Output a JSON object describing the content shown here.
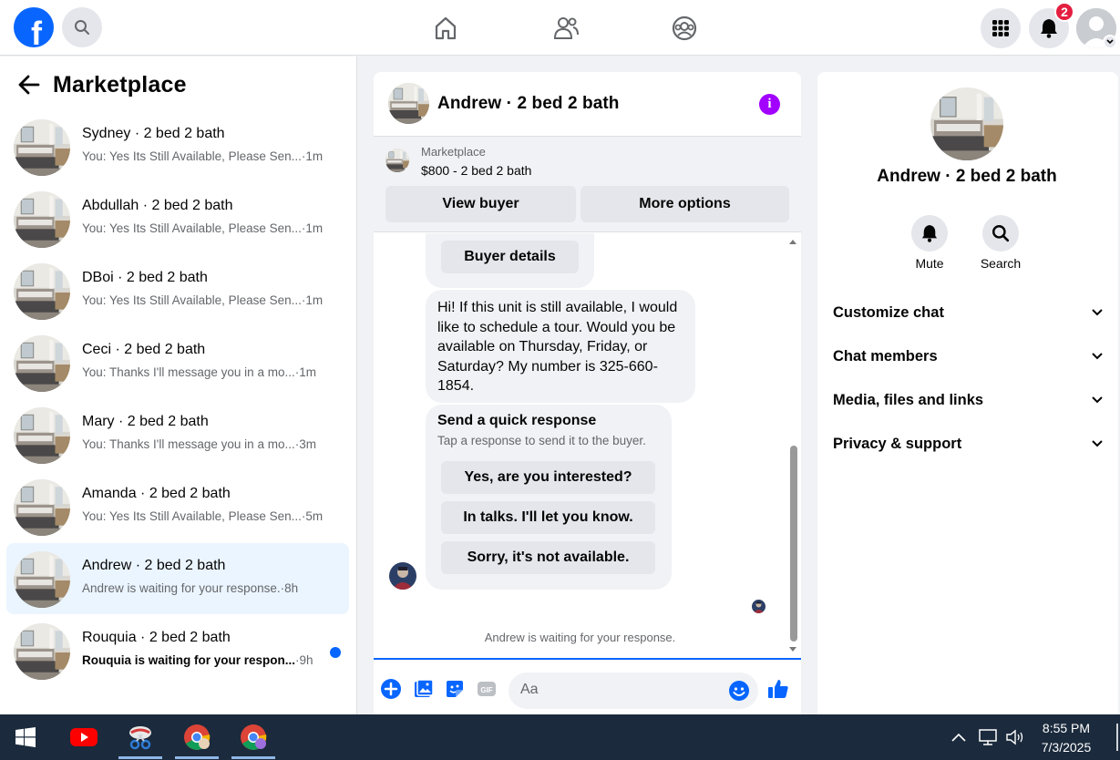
{
  "topbar": {
    "logo_letter": "f",
    "notifications_count": "2"
  },
  "sidebar": {
    "title": "Marketplace",
    "conversations": [
      {
        "name": "Sydney · 2 bed 2 bath",
        "snippet": "You: Yes Its Still Available, Please Sen...",
        "time": "·1m",
        "unread": false,
        "active": false
      },
      {
        "name": "Abdullah · 2 bed 2 bath",
        "snippet": "You: Yes Its Still Available, Please Sen...",
        "time": "·1m",
        "unread": false,
        "active": false
      },
      {
        "name": "DBoi · 2 bed 2 bath",
        "snippet": "You: Yes Its Still Available, Please Sen...",
        "time": "·1m",
        "unread": false,
        "active": false
      },
      {
        "name": "Ceci · 2 bed 2 bath",
        "snippet": "You: Thanks I'll message you in a mo...",
        "time": "·1m",
        "unread": false,
        "active": false
      },
      {
        "name": "Mary · 2 bed 2 bath",
        "snippet": "You: Thanks I'll message you in a mo...",
        "time": "·3m",
        "unread": false,
        "active": false
      },
      {
        "name": "Amanda · 2 bed 2 bath",
        "snippet": "You: Yes Its Still Available, Please Sen...",
        "time": "·5m",
        "unread": false,
        "active": false
      },
      {
        "name": "Andrew · 2 bed 2 bath",
        "snippet": "Andrew is waiting for your response.",
        "time": "·8h",
        "unread": false,
        "active": true
      },
      {
        "name": "Rouquia · 2 bed 2 bath",
        "snippet": "Rouquia is waiting for your respon...",
        "time": "·9h",
        "unread": true,
        "active": false
      }
    ]
  },
  "chat": {
    "title": "Andrew · 2 bed 2 bath",
    "listing": {
      "source": "Marketplace",
      "price_title": "$800 - 2 bed 2 bath",
      "view_buyer_label": "View buyer",
      "more_options_label": "More options"
    },
    "buyer_details_label": "Buyer details",
    "message": "Hi! If this unit is still available, I would like to schedule a tour. Would you be available on Thursday, Friday, or Saturday? My number is 325-660-1854.",
    "quick_response": {
      "title": "Send a quick response",
      "subtitle": "Tap a response to send it to the buyer.",
      "options": [
        "Yes, are you interested?",
        "In talks. I'll let you know.",
        "Sorry, it's not available."
      ]
    },
    "waiting_text": "Andrew is waiting for your response.",
    "composer": {
      "placeholder": "Aa"
    }
  },
  "details": {
    "name": "Andrew · 2 bed 2 bath",
    "actions": [
      {
        "label": "Mute"
      },
      {
        "label": "Search"
      }
    ],
    "sections": [
      "Customize chat",
      "Chat members",
      "Media, files and links",
      "Privacy & support"
    ]
  },
  "taskbar": {
    "time": "8:55 PM",
    "date": "7/3/2025"
  },
  "colors": {
    "brand_blue": "#0866ff",
    "active_row": "#ebf5ff",
    "info_purple": "#a200ff",
    "badge_red": "#e41e3f",
    "taskbar": "#1b2a3c"
  }
}
